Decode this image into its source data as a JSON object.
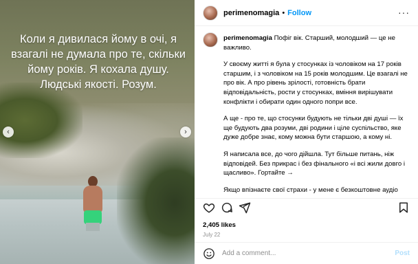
{
  "post": {
    "overlay_text": "Коли я дивилася йому в очі, я взагалі не думала про те, скільки йому років. Я кохала душу. Людські якості. Розум."
  },
  "header": {
    "username": "perimenomagia",
    "separator": "•",
    "follow_label": "Follow",
    "more_label": "···"
  },
  "caption": {
    "author": "perimenomagia",
    "paragraphs": [
      "Пофіг вік. Старший, молодший — це не важливо.",
      "У своєму житті я була у стосунках із чоловіком на 17 років старшим, і з чоловіком на 15 років молодшим. Це взагалі не про вік. А про рівень зрілості, готовність брати відповідальність, рости у стосунках, вміння вирішувати конфлікти і обирати один одного попри все.",
      "А ще - про те, що стосунки будують не тільки дві душі — їх ще будують два розуми, дві родини і ціле суспільство, яке дуже добре знає, кому можна бути старшою, а кому ні.",
      "Я написала все, до чого дійшла. Тут більше питань, ніж відповідей. Без прикрас і без фінального «і всі жили довго і щасливо». Гортайте →",
      "Якщо впізнаєте свої страхи - у мене є безкоштовне аудіо «ОК, тобі страшно. Що далі?» За кодовим словом «69» в коментарях отримаєте на нього посилання."
    ]
  },
  "stats": {
    "likes": "2,405 likes",
    "date": "July 22"
  },
  "comment": {
    "placeholder": "Add a comment...",
    "post_label": "Post"
  },
  "icons": {
    "like": "heart-icon",
    "comment": "comment-icon",
    "share": "share-icon",
    "save": "bookmark-icon",
    "emoji": "emoji-icon",
    "prev": "chevron-left-icon",
    "next": "chevron-right-icon"
  },
  "colors": {
    "follow": "#0095f6",
    "muted": "#8e8e8e",
    "post_disabled": "#b2dffc"
  }
}
